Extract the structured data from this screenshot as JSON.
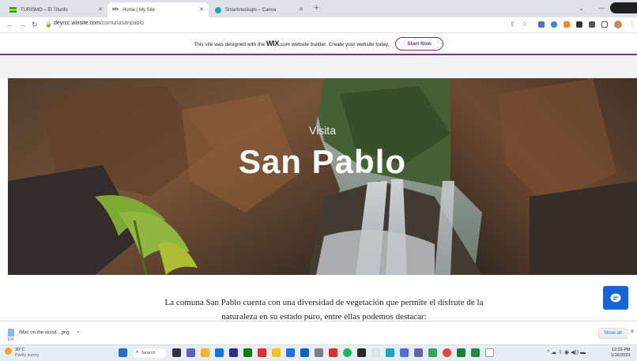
{
  "browser": {
    "tabs": [
      {
        "title": "TURISMO – El Triunfo",
        "favicon": "flag-icon",
        "active": false
      },
      {
        "title": "Home | My Site",
        "favicon": "wix-icon",
        "active": true
      },
      {
        "title": "Smartmockups – Canva",
        "favicon": "canva-icon",
        "active": false
      }
    ],
    "new_tab_label": "+",
    "url_domain": "deyrcc.wixsite.com",
    "url_path": "/comunasanpablo"
  },
  "wix_banner": {
    "message_pre": "This site was designed with the",
    "brand": "WIX",
    "brand_suffix": ".com",
    "message_post": "website builder. Create your website today.",
    "cta_label": "Start Now",
    "accent_color": "#7b2d8e"
  },
  "hero": {
    "kicker": "Visita",
    "title": "San Pablo"
  },
  "content": {
    "paragraph_line1": "La comuna San Pablo cuenta con una diversidad de vegetación que permite el disfrute de la",
    "paragraph_line2": "naturaleza en su estado puro, entre ellas podemos destacar:"
  },
  "chat_button": {
    "icon": "chat-icon",
    "color": "#1565d8"
  },
  "downloads": {
    "item_label": "iMac on the wood....png",
    "locale": "EN",
    "show_all_label": "Show all",
    "close_label": "✕"
  },
  "taskbar": {
    "weather_temp": "30°C",
    "weather_desc": "Partly sunny",
    "search_label": "Search",
    "time": "12:03 PM",
    "date": "1/16/2023"
  }
}
